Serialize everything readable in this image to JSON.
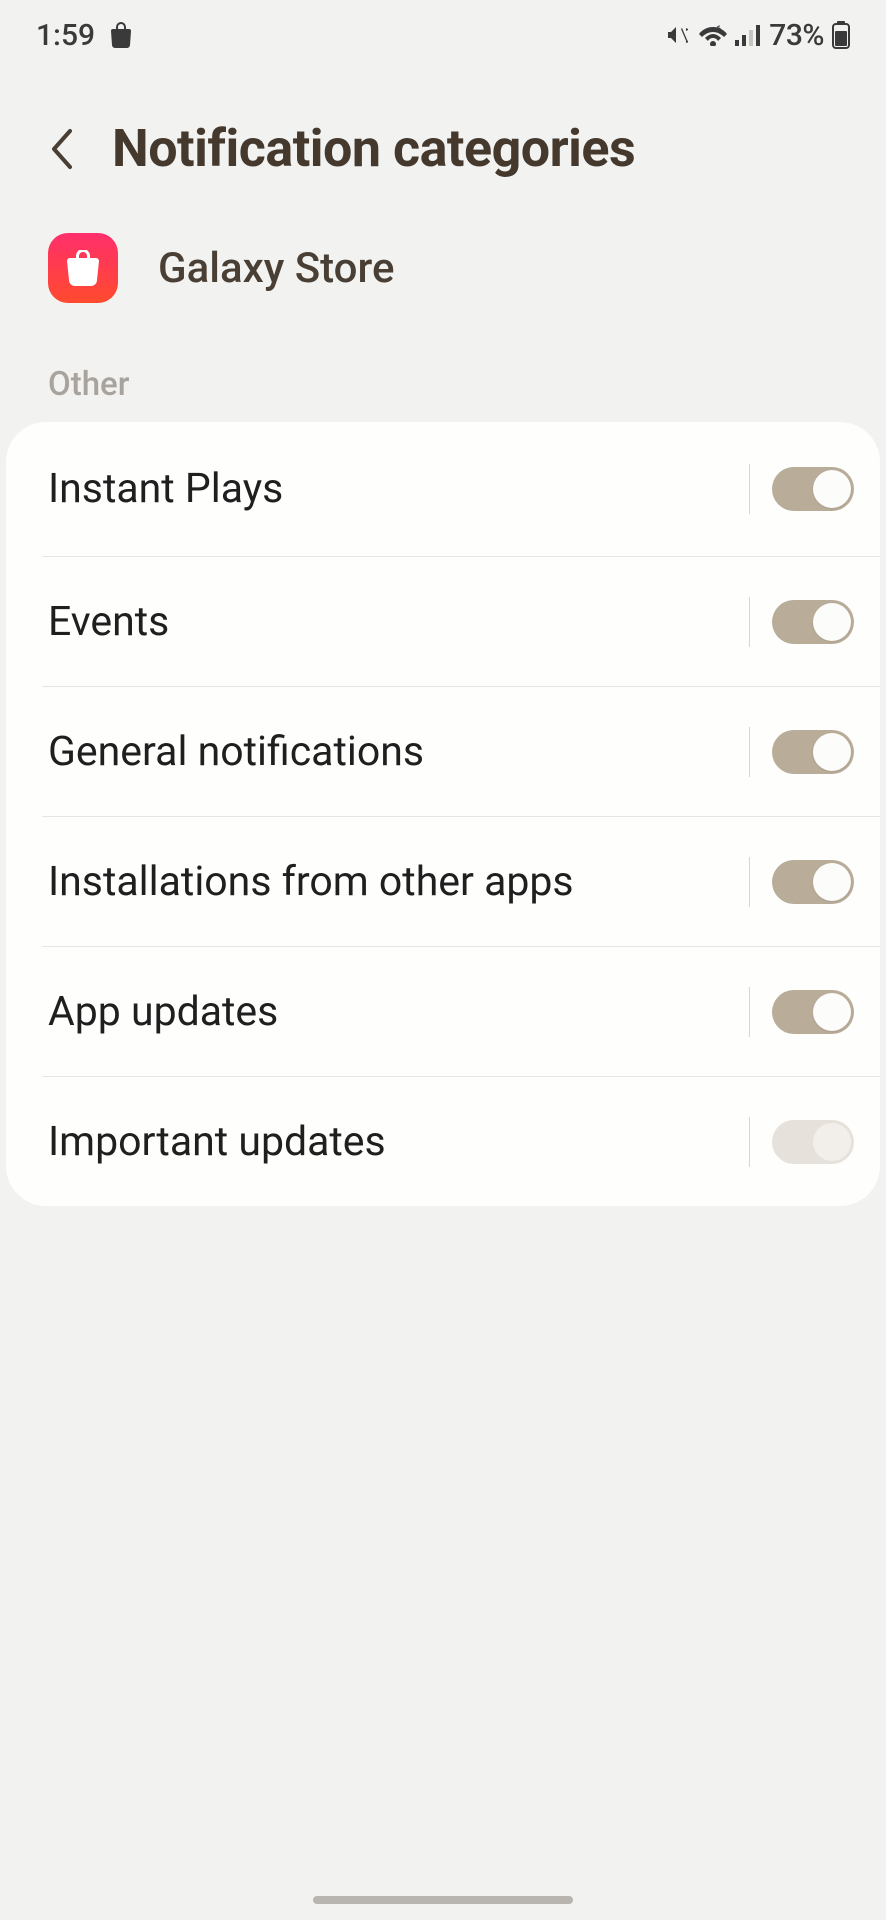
{
  "status": {
    "time": "1:59",
    "battery_pct": "73%"
  },
  "header": {
    "title": "Notification categories"
  },
  "app": {
    "name": "Galaxy Store"
  },
  "section_label": "Other",
  "rows": [
    {
      "label": "Instant Plays",
      "on": true
    },
    {
      "label": "Events",
      "on": true
    },
    {
      "label": "General notifications",
      "on": true
    },
    {
      "label": "Installations from other apps",
      "on": true
    },
    {
      "label": "App updates",
      "on": true
    },
    {
      "label": "Important updates",
      "on": false
    }
  ]
}
